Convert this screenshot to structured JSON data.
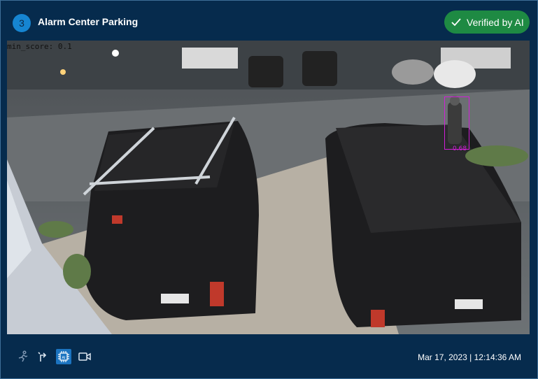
{
  "camera": {
    "number": "3",
    "name": "Alarm Center Parking"
  },
  "status": {
    "verified_label": "Verified by AI",
    "color": "#1e8a43"
  },
  "overlay": {
    "min_score": "min_score: 0.1"
  },
  "detection": {
    "label": "0.68"
  },
  "toolbar": {
    "icons": [
      "running-person-icon",
      "turn-arrow-icon",
      "ai-chip-icon",
      "video-camera-icon"
    ],
    "active": "ai-chip-icon"
  },
  "footer": {
    "timestamp": "Mar 17, 2023 | 12:14:36 AM"
  },
  "colors": {
    "background": "#062b4d",
    "border": "#3f6f98",
    "badge": "#1685d1",
    "active_tool": "#1c74c0",
    "detection": "#d11ed8"
  }
}
